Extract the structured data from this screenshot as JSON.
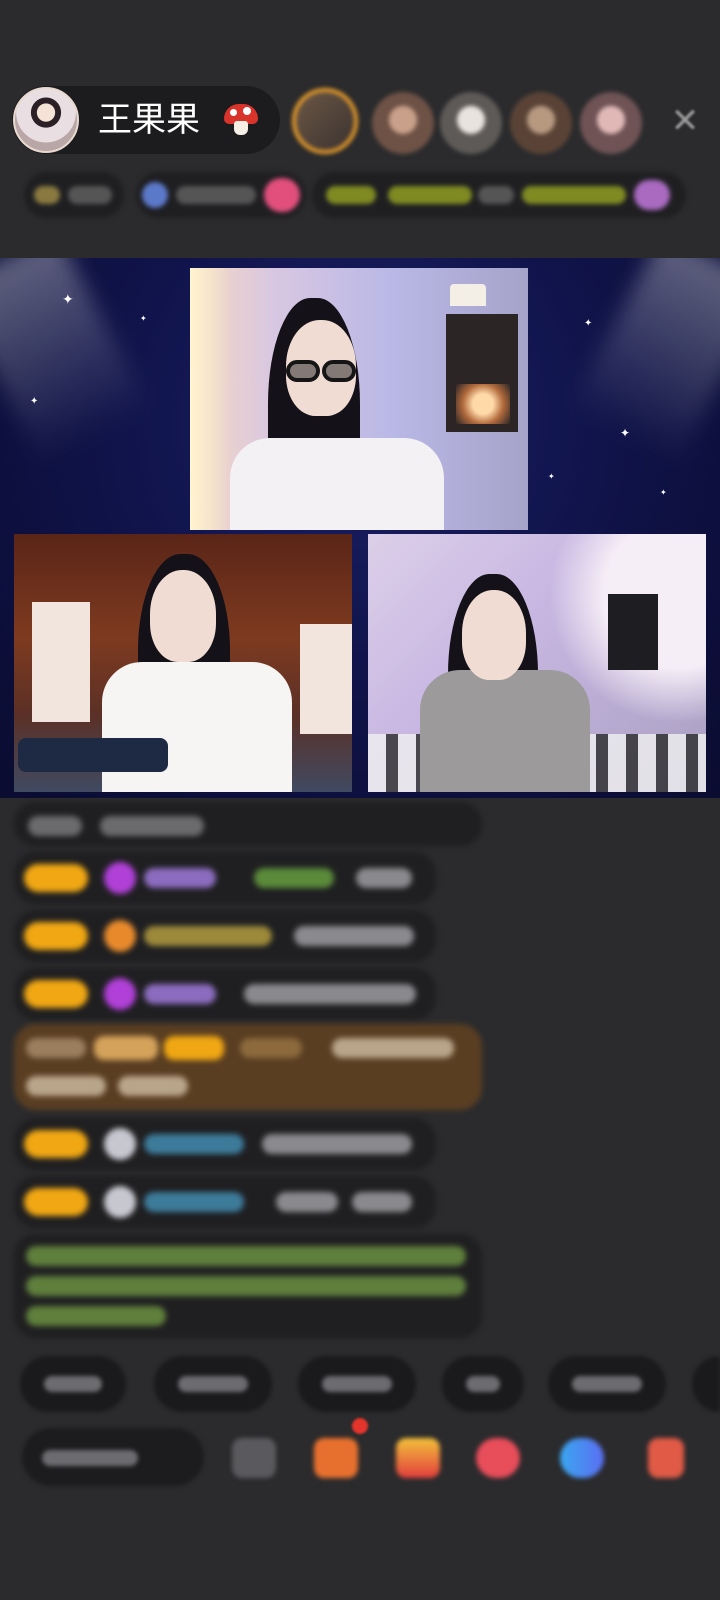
{
  "header": {
    "host_name": "王果果",
    "host_badge_icon": "mushroom-icon",
    "viewer_count_avatars": 5,
    "close_icon": "close-icon"
  },
  "stage": {
    "layout": "three-way co-host video",
    "cameras": [
      "top",
      "bottom-left",
      "bottom-right"
    ],
    "background_color": "#0f1246"
  },
  "chat": {
    "level_badge_color": "#f0a713",
    "messages_blurred": 8
  },
  "toolbar": {
    "quick_replies": 5,
    "tools": [
      "emoji-icon",
      "gift-box-icon",
      "red-envelope-icon",
      "game-icon",
      "chat-icon",
      "grid-icon"
    ]
  },
  "colors": {
    "background": "#2b2b2d",
    "accent_orange": "#e49a2a",
    "level_gold": "#f0a713",
    "highlight_green": "#7fb24a"
  }
}
